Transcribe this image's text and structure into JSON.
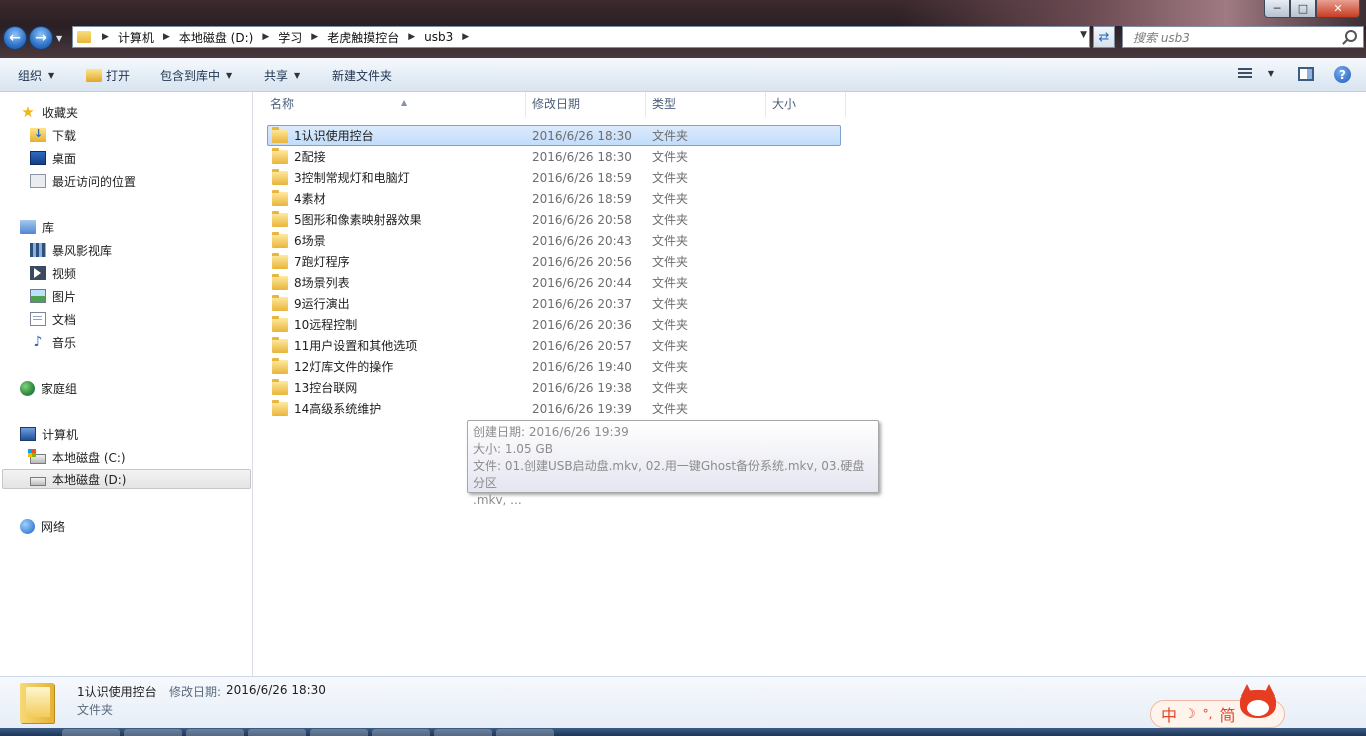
{
  "window": {
    "minimize_label": "─",
    "maximize_label": "□",
    "close_label": "✕"
  },
  "address": {
    "crumbs": [
      "计算机",
      "本地磁盘 (D:)",
      "学习",
      "老虎触摸控台",
      "usb3"
    ]
  },
  "search": {
    "placeholder": "搜索 usb3"
  },
  "toolbar": {
    "organize": "组织",
    "open": "打开",
    "include_in_library": "包含到库中",
    "share": "共享",
    "new_folder": "新建文件夹"
  },
  "nav": {
    "favorites": "收藏夹",
    "downloads": "下载",
    "desktop": "桌面",
    "recent": "最近访问的位置",
    "libraries": "库",
    "storm_library": "暴风影视库",
    "videos": "视频",
    "pictures": "图片",
    "documents": "文档",
    "music": "音乐",
    "homegroup": "家庭组",
    "computer": "计算机",
    "drive_c": "本地磁盘 (C:)",
    "drive_d": "本地磁盘 (D:)",
    "network": "网络"
  },
  "columns": {
    "name": "名称",
    "date": "修改日期",
    "type": "类型",
    "size": "大小"
  },
  "files": [
    {
      "name": "1认识使用控台",
      "date": "2016/6/26 18:30",
      "type": "文件夹"
    },
    {
      "name": "2配接",
      "date": "2016/6/26 18:30",
      "type": "文件夹"
    },
    {
      "name": "3控制常规灯和电脑灯",
      "date": "2016/6/26 18:59",
      "type": "文件夹"
    },
    {
      "name": "4素材",
      "date": "2016/6/26 18:59",
      "type": "文件夹"
    },
    {
      "name": "5图形和像素映射器效果",
      "date": "2016/6/26 20:58",
      "type": "文件夹"
    },
    {
      "name": "6场景",
      "date": "2016/6/26 20:43",
      "type": "文件夹"
    },
    {
      "name": "7跑灯程序",
      "date": "2016/6/26 20:56",
      "type": "文件夹"
    },
    {
      "name": "8场景列表",
      "date": "2016/6/26 20:44",
      "type": "文件夹"
    },
    {
      "name": "9运行演出",
      "date": "2016/6/26 20:37",
      "type": "文件夹"
    },
    {
      "name": "10远程控制",
      "date": "2016/6/26 20:36",
      "type": "文件夹"
    },
    {
      "name": "11用户设置和其他选项",
      "date": "2016/6/26 20:57",
      "type": "文件夹"
    },
    {
      "name": "12灯库文件的操作",
      "date": "2016/6/26 19:40",
      "type": "文件夹"
    },
    {
      "name": "13控台联网",
      "date": "2016/6/26 19:38",
      "type": "文件夹"
    },
    {
      "name": "14高级系统维护",
      "date": "2016/6/26 19:39",
      "type": "文件夹"
    }
  ],
  "tooltip": {
    "created": "创建日期: 2016/6/26 19:39",
    "size": "大小: 1.05 GB",
    "files_line1": "文件: 01.创建USB启动盘.mkv, 02.用一键Ghost备份系统.mkv, 03.硬盘分区",
    "files_line2": ".mkv, ..."
  },
  "details": {
    "name": "1认识使用控台",
    "date_label": "修改日期:",
    "date": "2016/6/26 18:30",
    "type": "文件夹"
  },
  "ime": {
    "mode": "中",
    "moon": "☽",
    "punct": "°,",
    "script": "简"
  },
  "colors": {
    "selection": "#cce4fb",
    "accent": "#2f73c9"
  }
}
